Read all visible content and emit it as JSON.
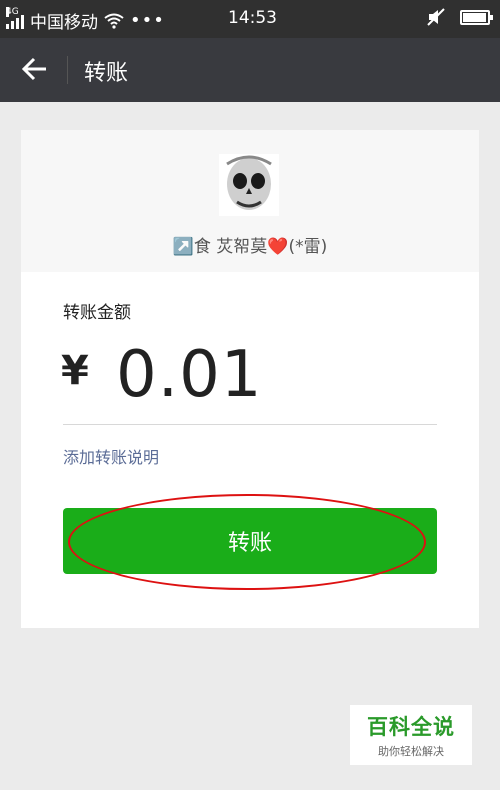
{
  "status_bar": {
    "network": "4G",
    "carrier": "中国移动",
    "time": "14:53",
    "battery_level": 0.95
  },
  "nav": {
    "title": "转账"
  },
  "payee": {
    "name": "↗️食 炗帤莫❤️(*雷)"
  },
  "transfer": {
    "amount_label": "转账金额",
    "currency_symbol": "¥",
    "amount": "0.01",
    "add_note_link": "添加转账说明",
    "submit_label": "转账"
  },
  "watermark": {
    "title": "百科全说",
    "subtitle": "助你轻松解决"
  },
  "colors": {
    "status_bar_bg": "#303030",
    "nav_bg": "#393a3f",
    "button_green": "#1aad19",
    "link_blue": "#5b6c96",
    "annotation_red": "#dd1111"
  }
}
